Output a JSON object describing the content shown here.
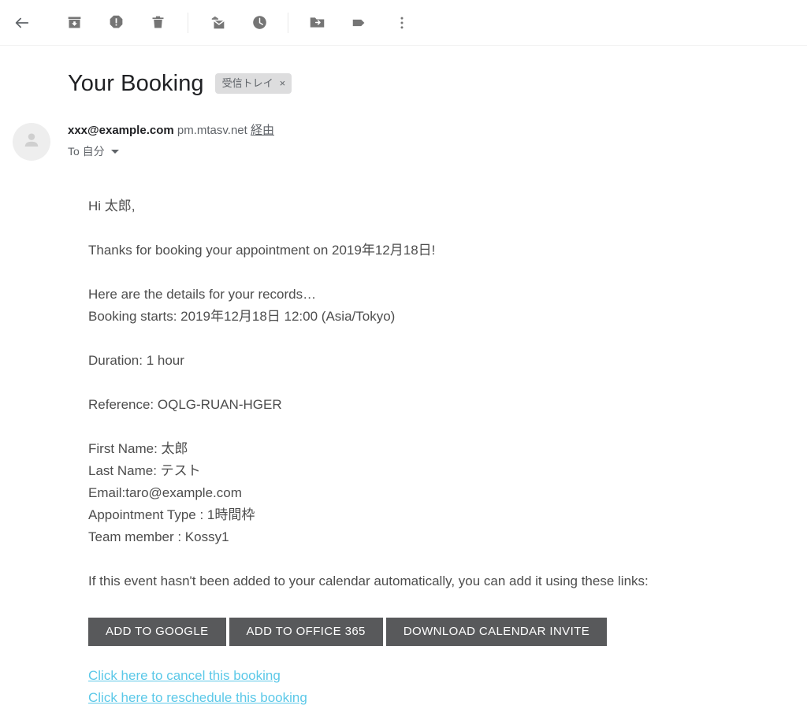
{
  "toolbar": {
    "back_label": "戻る",
    "items": [
      {
        "name": "archive-icon",
        "label": "アーカイブ"
      },
      {
        "name": "report-spam-icon",
        "label": "迷惑メールを報告"
      },
      {
        "name": "delete-icon",
        "label": "削除"
      },
      {
        "name": "mark-unread-icon",
        "label": "未読にする"
      },
      {
        "name": "snooze-icon",
        "label": "スヌーズ"
      },
      {
        "name": "move-to-icon",
        "label": "移動"
      },
      {
        "name": "labels-icon",
        "label": "ラベル"
      },
      {
        "name": "more-icon",
        "label": "その他"
      }
    ]
  },
  "subject": {
    "title": "Your Booking",
    "label_chip": "受信トレイ",
    "label_chip_remove": "×"
  },
  "sender": {
    "email": "xxx@example.com",
    "via_domain": "pm.mtasv.net",
    "via_word": "経由",
    "recipient": "To 自分"
  },
  "body": {
    "greeting": "Hi 太郎,",
    "thanks": "Thanks for booking your appointment on 2019年12月18日!",
    "details_intro": "Here are the details for your records…",
    "booking_starts": "Booking starts: 2019年12月18日 12:00 (Asia/Tokyo)",
    "duration": "Duration: 1 hour",
    "reference": "Reference: OQLG-RUAN-HGER",
    "first_name": "First Name: 太郎",
    "last_name": "Last Name: テスト",
    "email_line": "Email:taro@example.com",
    "appointment_type": "Appointment Type : 1時間枠",
    "team_member": "Team member : Kossy1",
    "calendar_note": "If this event hasn't been added to your calendar automatically, you can add it using these links:"
  },
  "calendar_buttons": [
    {
      "label": "ADD TO GOOGLE"
    },
    {
      "label": "ADD TO OFFICE 365"
    },
    {
      "label": "DOWNLOAD CALENDAR INVITE"
    }
  ],
  "links": {
    "cancel": "Click here to cancel this booking",
    "reschedule": "Click here to reschedule this booking"
  },
  "colors": {
    "button_bg": "#58595b",
    "link": "#5bc8e8",
    "body_text": "#4d4d4d",
    "icon": "#757575",
    "chip_bg": "#ddddde"
  }
}
